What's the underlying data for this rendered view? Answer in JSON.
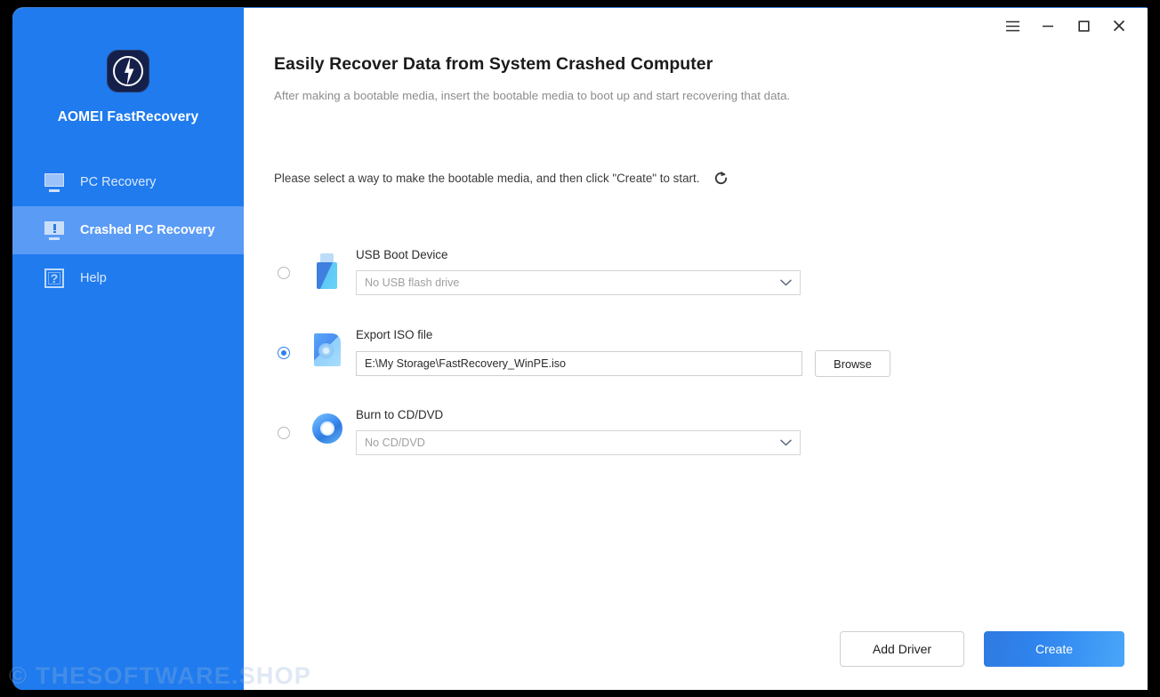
{
  "window": {
    "titlebar": {
      "menu_icon": "hamburger-menu-icon",
      "minimize_icon": "minimize-icon",
      "maximize_icon": "maximize-icon",
      "close_icon": "close-icon"
    }
  },
  "sidebar": {
    "brand_name": "AOMEI FastRecovery",
    "logo_icon": "lightning-bolt-logo-icon",
    "items": [
      {
        "label": "PC Recovery",
        "icon": "monitor-icon",
        "active": false
      },
      {
        "label": "Crashed PC Recovery",
        "icon": "monitor-alert-icon",
        "active": true
      },
      {
        "label": "Help",
        "icon": "question-mark-icon",
        "active": false
      }
    ]
  },
  "main": {
    "title": "Easily Recover Data from System Crashed Computer",
    "subtitle": "After making a bootable media, insert the bootable media to boot up and start recovering that data.",
    "instruction": "Please select a way to make the bootable media, and then click \"Create\" to start.",
    "refresh_icon": "refresh-icon"
  },
  "options": [
    {
      "id": "usb",
      "label": "USB Boot Device",
      "icon": "usb-flash-drive-icon",
      "selected": false,
      "control": "dropdown",
      "placeholder": "No USB flash drive",
      "value": "",
      "chevron_icon": "chevron-down-icon"
    },
    {
      "id": "iso",
      "label": "Export ISO file",
      "icon": "iso-file-icon",
      "selected": true,
      "control": "textbox",
      "placeholder": "",
      "value": "E:\\My Storage\\FastRecovery_WinPE.iso",
      "browse_label": "Browse"
    },
    {
      "id": "cd",
      "label": "Burn to CD/DVD",
      "icon": "cd-dvd-disc-icon",
      "selected": false,
      "control": "dropdown",
      "placeholder": "No CD/DVD",
      "value": "",
      "chevron_icon": "chevron-down-icon"
    }
  ],
  "footer": {
    "add_driver_label": "Add Driver",
    "create_label": "Create"
  },
  "watermark": "© THESOFTWARE.SHOP",
  "colors": {
    "sidebar_bg": "#1f7bee",
    "sidebar_active_bg": "#5a9bf5",
    "accent": "#2f80ed",
    "primary_button_from": "#2f7ae0",
    "primary_button_to": "#4aa6f8",
    "logo_bg": "#14204a",
    "title_text": "#1b1b1b",
    "subtitle_text": "#8c8c8c",
    "placeholder_text": "#a0a0a0"
  }
}
